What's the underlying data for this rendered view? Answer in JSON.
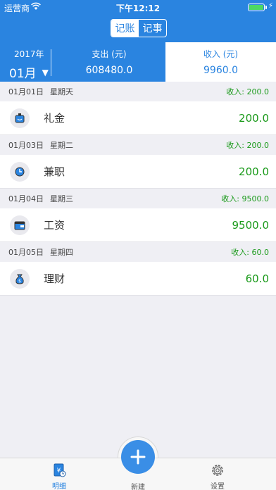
{
  "status_bar": {
    "carrier": "运营商",
    "time": "下午12:12"
  },
  "segment": {
    "bookkeeping": "记账",
    "notes": "记事"
  },
  "summary": {
    "year": "2017年",
    "month": "01月",
    "expense_label": "支出 (元)",
    "expense_value": "608480.0",
    "income_label": "收入 (元)",
    "income_value": "9960.0"
  },
  "days": [
    {
      "date": "01月01日",
      "weekday": "星期天",
      "total": "收入: 200.0",
      "entries": [
        {
          "icon": "gift-icon",
          "name": "礼金",
          "amount": "200.0"
        }
      ]
    },
    {
      "date": "01月03日",
      "weekday": "星期二",
      "total": "收入: 200.0",
      "entries": [
        {
          "icon": "part-time-clock-icon",
          "name": "兼职",
          "amount": "200.0"
        }
      ]
    },
    {
      "date": "01月04日",
      "weekday": "星期三",
      "total": "收入: 9500.0",
      "entries": [
        {
          "icon": "wallet-icon",
          "name": "工资",
          "amount": "9500.0"
        }
      ]
    },
    {
      "date": "01月05日",
      "weekday": "星期四",
      "total": "收入: 60.0",
      "entries": [
        {
          "icon": "money-bag-icon",
          "name": "理财",
          "amount": "60.0"
        }
      ]
    }
  ],
  "tabbar": {
    "detail": "明细",
    "new": "新建",
    "settings": "设置"
  },
  "colors": {
    "primary": "#2a84e0",
    "income_green": "#1a9a1a",
    "background": "#efeff4"
  }
}
